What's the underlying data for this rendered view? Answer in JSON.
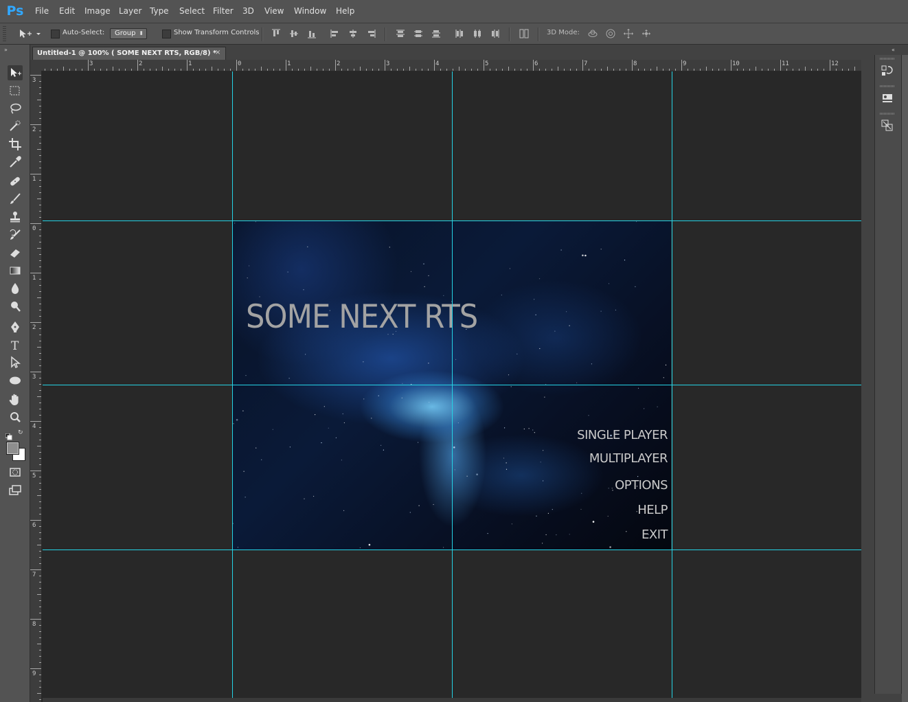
{
  "app": {
    "logo": "Ps"
  },
  "menu": [
    "File",
    "Edit",
    "Image",
    "Layer",
    "Type",
    "Select",
    "Filter",
    "3D",
    "View",
    "Window",
    "Help"
  ],
  "options": {
    "auto_select_label": "Auto-Select:",
    "group_value": "Group",
    "show_transform_label": "Show Transform Controls",
    "mode_3d_label": "3D Mode:"
  },
  "document": {
    "tab_title": "Untitled-1 @ 100% ( SOME NEXT RTS, RGB/8) *",
    "close_glyph": "×"
  },
  "rulers": {
    "horizontal_labels": [
      "3",
      "2",
      "1",
      "0",
      "1",
      "2",
      "3",
      "4",
      "5",
      "6",
      "7",
      "8",
      "9",
      "10",
      "11",
      "12"
    ],
    "vertical_labels": [
      "3",
      "2",
      "1",
      "0",
      "1",
      "2",
      "3",
      "4",
      "5",
      "6",
      "7",
      "8",
      "9"
    ]
  },
  "artwork": {
    "title": "SOME NEXT RTS",
    "menu_options": [
      "SINGLE PLAYER",
      "MULTIPLAYER",
      "OPTIONS",
      "HELP",
      "EXIT"
    ]
  },
  "colors": {
    "guide": "#25d4e6",
    "ui_bg": "#535353",
    "canvas_bg": "#282828",
    "logo": "#31a8ff"
  },
  "tools": [
    "move-tool",
    "marquee-tool",
    "lasso-tool",
    "quick-selection-tool",
    "crop-tool",
    "eyedropper-tool",
    "healing-brush-tool",
    "brush-tool",
    "clone-stamp-tool",
    "history-brush-tool",
    "eraser-tool",
    "gradient-tool",
    "blur-tool",
    "dodge-tool",
    "pen-tool",
    "type-tool",
    "path-selection-tool",
    "ellipse-tool",
    "hand-tool",
    "zoom-tool",
    "swap-colors-icon",
    "color-swatches",
    "quick-mask-icon",
    "screen-mode-icon"
  ]
}
